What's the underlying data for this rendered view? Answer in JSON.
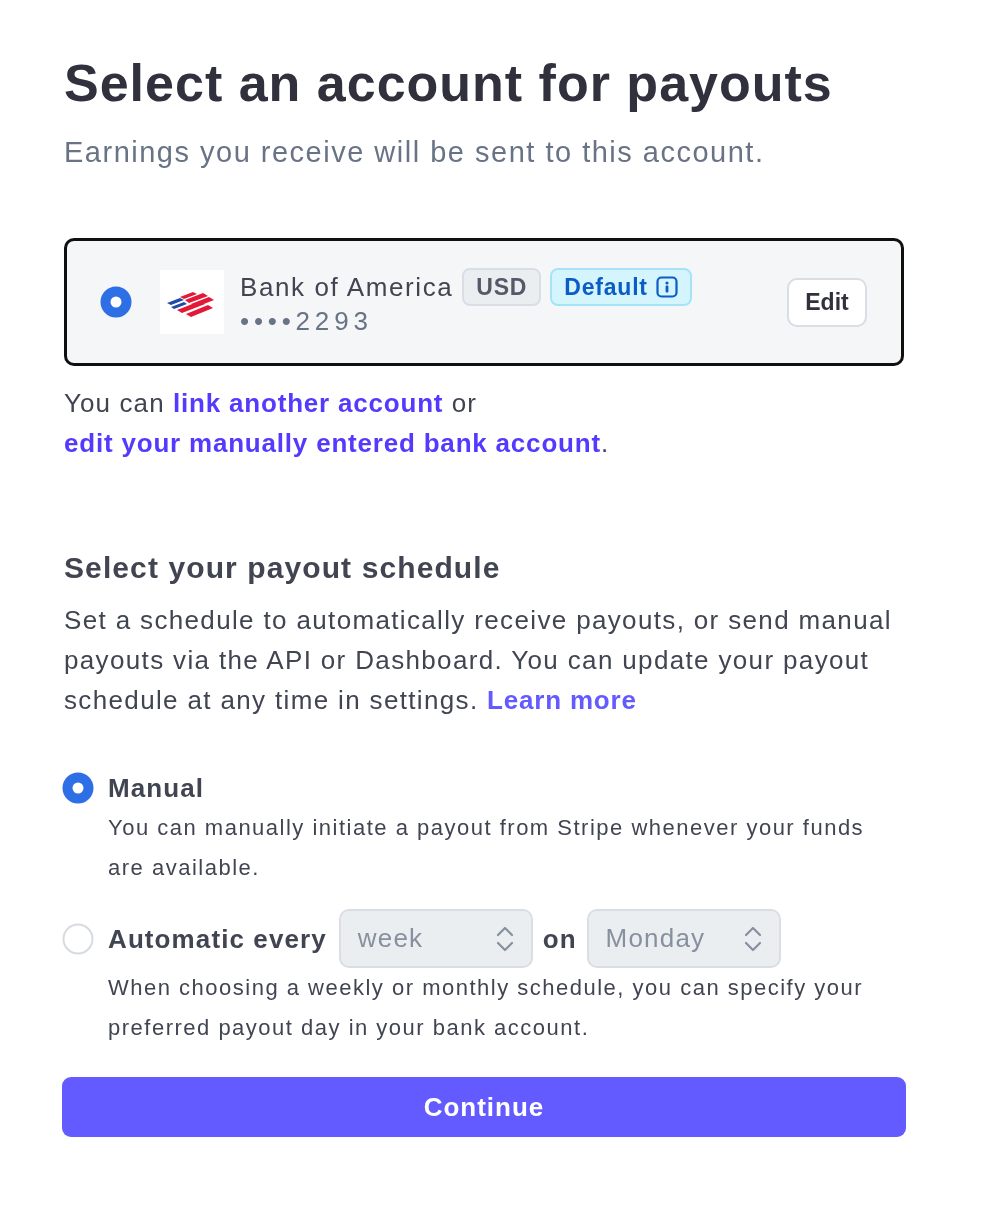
{
  "header": {
    "title": "Select an account for payouts",
    "subtitle": "Earnings you receive will be sent to this account."
  },
  "account": {
    "selected": true,
    "bank_name": "Bank of America",
    "currency": "USD",
    "badge": "Default",
    "number": "••••2293",
    "edit_button": "Edit"
  },
  "account_note": [
    {
      "kind": "text",
      "text": "You can "
    },
    {
      "kind": "link",
      "text": "link another account"
    },
    {
      "kind": "text",
      "text": " or "
    },
    {
      "kind": "link",
      "text": "edit your manually entered bank account"
    },
    {
      "kind": "text",
      "text": "."
    }
  ],
  "schedule": {
    "title": "Select your payout schedule",
    "description": "Set a schedule to automatically receive payouts, or send manual payouts via the API or Dashboard. You can update your payout schedule at any time in settings.",
    "learn_more": "Learn more",
    "options": [
      {
        "kind": "manual",
        "label": "Manual",
        "selected": true,
        "description": "You can manually initiate a payout from Stripe whenever your funds are available."
      },
      {
        "kind": "automatic",
        "label": "Automatic every",
        "selected": false,
        "interval": "week",
        "connector": "on",
        "day": "Monday",
        "description": "When choosing a weekly or monthly schedule, you can specify your preferred payout day in your bank account."
      }
    ]
  },
  "continue_button": "Continue"
}
